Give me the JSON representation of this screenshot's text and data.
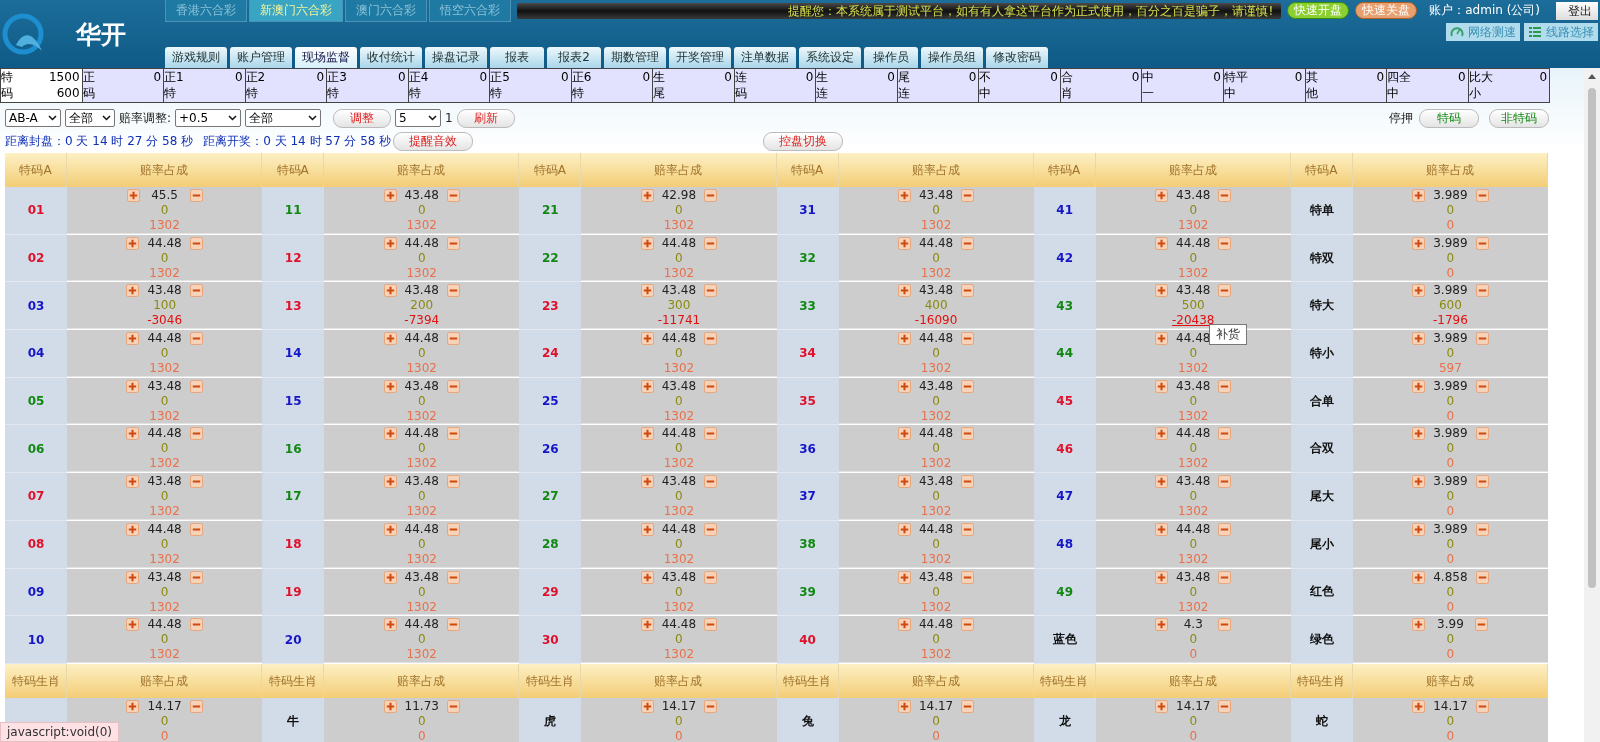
{
  "logo_text": "华开",
  "lottery_tabs": [
    {
      "label": "香港六合彩",
      "selected": false
    },
    {
      "label": "新澳门六合彩",
      "selected": true
    },
    {
      "label": "澳门六合彩",
      "selected": false
    },
    {
      "label": "悟空六合彩",
      "selected": false
    }
  ],
  "notice": "提醒您：本系统属于测试平台，如有有人拿这平台作为正式使用，百分之百是骗子，请谨慎!",
  "quick_buttons": [
    {
      "label": "快速开盘",
      "kind": "open"
    },
    {
      "label": "快速关盘",
      "kind": "close"
    }
  ],
  "account": "账户：admin (公司)",
  "logout": "登出",
  "tools": [
    {
      "label": "网络测速",
      "kind": "speed"
    },
    {
      "label": "线路选择",
      "kind": "list"
    }
  ],
  "nav": [
    {
      "label": "游戏规则",
      "selected": false
    },
    {
      "label": "账户管理",
      "selected": false
    },
    {
      "label": "现场监督",
      "selected": true
    },
    {
      "label": "收付统计",
      "selected": false
    },
    {
      "label": "操盘记录",
      "selected": false
    },
    {
      "label": "报表",
      "selected": false
    },
    {
      "label": "报表2",
      "selected": false
    },
    {
      "label": "期数管理",
      "selected": false
    },
    {
      "label": "开奖管理",
      "selected": false
    },
    {
      "label": "注单数据",
      "selected": false
    },
    {
      "label": "系统设定",
      "selected": false
    },
    {
      "label": "操作员",
      "selected": false
    },
    {
      "label": "操作员组",
      "selected": false
    },
    {
      "label": "修改密码",
      "selected": false
    }
  ],
  "summary": [
    {
      "name": [
        "特",
        "码"
      ],
      "values": [
        "1500",
        "600"
      ],
      "selected": true
    },
    {
      "name": [
        "正",
        "码"
      ],
      "values": [
        "0"
      ],
      "selected": false
    },
    {
      "name": [
        "正1",
        "特"
      ],
      "values": [
        "0"
      ],
      "selected": false
    },
    {
      "name": [
        "正2",
        "特"
      ],
      "values": [
        "0"
      ],
      "selected": false
    },
    {
      "name": [
        "正3",
        "特"
      ],
      "values": [
        "0"
      ],
      "selected": false
    },
    {
      "name": [
        "正4",
        "特"
      ],
      "values": [
        "0"
      ],
      "selected": false
    },
    {
      "name": [
        "正5",
        "特"
      ],
      "values": [
        "0"
      ],
      "selected": false
    },
    {
      "name": [
        "正6",
        "特"
      ],
      "values": [
        "0"
      ],
      "selected": false
    },
    {
      "name": [
        "生",
        "尾"
      ],
      "values": [
        "0"
      ],
      "selected": false
    },
    {
      "name": [
        "连",
        "码"
      ],
      "values": [
        "0"
      ],
      "selected": false
    },
    {
      "name": [
        "生",
        "连"
      ],
      "values": [
        "0"
      ],
      "selected": false
    },
    {
      "name": [
        "尾",
        "连"
      ],
      "values": [
        "0"
      ],
      "selected": false
    },
    {
      "name": [
        "不",
        "中"
      ],
      "values": [
        "0"
      ],
      "selected": false
    },
    {
      "name": [
        "合",
        "肖"
      ],
      "values": [
        "0"
      ],
      "selected": false
    },
    {
      "name": [
        "中",
        "一"
      ],
      "values": [
        "0"
      ],
      "selected": false
    },
    {
      "name": [
        "特平",
        "中"
      ],
      "values": [
        "0"
      ],
      "selected": false
    },
    {
      "name": [
        "其",
        "他"
      ],
      "values": [
        "0"
      ],
      "selected": false
    },
    {
      "name": [
        "四全",
        "中"
      ],
      "values": [
        "0"
      ],
      "selected": false
    },
    {
      "name": [
        "比大",
        "小"
      ],
      "values": [
        "0"
      ],
      "selected": false
    }
  ],
  "controls": {
    "selects": [
      "AB-A",
      "全部"
    ],
    "odds_label": "赔率调整:",
    "odds_selects": [
      "+0.5",
      "全部"
    ],
    "adjust_button": "调整",
    "count_select": "5",
    "count_text": "1",
    "refresh_button": "刷新",
    "stop_label": "停押",
    "stop_buttons": [
      "特码",
      "非特码"
    ]
  },
  "timers": {
    "close": "距离封盘：0 天 14 时 27 分 58 秒",
    "draw": "距离开奖：0 天 14 时 57 分 58 秒",
    "sound_button": "提醒音效",
    "switch_button": "控盘切换"
  },
  "tooltip": "补货",
  "status_text": "javascript:void(0)",
  "sections": [
    {
      "headers": [
        "特码A",
        "赔率占成",
        "特码A",
        "赔率占成",
        "特码A",
        "赔率占成",
        "特码A",
        "赔率占成",
        "特码A",
        "赔率占成",
        "特码A",
        "赔率占成"
      ],
      "rows": [
        [
          {
            "label": "01",
            "color": "#e0102a",
            "odds": "45.5",
            "stake": "0",
            "result": "1302",
            "loss": false
          },
          {
            "label": "11",
            "color": "#118811",
            "odds": "43.48",
            "stake": "0",
            "result": "1302",
            "loss": false
          },
          {
            "label": "21",
            "color": "#118811",
            "odds": "42.98",
            "stake": "0",
            "result": "1302",
            "loss": false
          },
          {
            "label": "31",
            "color": "#1515c8",
            "odds": "43.48",
            "stake": "0",
            "result": "1302",
            "loss": false
          },
          {
            "label": "41",
            "color": "#1515c8",
            "odds": "43.48",
            "stake": "0",
            "result": "1302",
            "loss": false
          },
          {
            "label": "特单",
            "odds": "3.989",
            "stake": "0",
            "result": "0",
            "loss": false
          }
        ],
        [
          {
            "label": "02",
            "color": "#e0102a",
            "odds": "44.48",
            "stake": "0",
            "result": "1302",
            "loss": false
          },
          {
            "label": "12",
            "color": "#e0102a",
            "odds": "44.48",
            "stake": "0",
            "result": "1302",
            "loss": false
          },
          {
            "label": "22",
            "color": "#118811",
            "odds": "44.48",
            "stake": "0",
            "result": "1302",
            "loss": false
          },
          {
            "label": "32",
            "color": "#118811",
            "odds": "44.48",
            "stake": "0",
            "result": "1302",
            "loss": false
          },
          {
            "label": "42",
            "color": "#1515c8",
            "odds": "44.48",
            "stake": "0",
            "result": "1302",
            "loss": false
          },
          {
            "label": "特双",
            "odds": "3.989",
            "stake": "0",
            "result": "0",
            "loss": false
          }
        ],
        [
          {
            "label": "03",
            "color": "#1515c8",
            "odds": "43.48",
            "stake": "100",
            "result": "-3046",
            "loss": true
          },
          {
            "label": "13",
            "color": "#e0102a",
            "odds": "43.48",
            "stake": "200",
            "result": "-7394",
            "loss": true
          },
          {
            "label": "23",
            "color": "#e0102a",
            "odds": "43.48",
            "stake": "300",
            "result": "-11741",
            "loss": true
          },
          {
            "label": "33",
            "color": "#118811",
            "odds": "43.48",
            "stake": "400",
            "result": "-16090",
            "loss": true
          },
          {
            "label": "43",
            "color": "#118811",
            "odds": "43.48",
            "stake": "500",
            "result": "-20438",
            "loss": true,
            "hovered": true
          },
          {
            "label": "特大",
            "odds": "3.989",
            "stake": "600",
            "result": "-1796",
            "loss": true
          }
        ],
        [
          {
            "label": "04",
            "color": "#1515c8",
            "odds": "44.48",
            "stake": "0",
            "result": "1302",
            "loss": false
          },
          {
            "label": "14",
            "color": "#1515c8",
            "odds": "44.48",
            "stake": "0",
            "result": "1302",
            "loss": false
          },
          {
            "label": "24",
            "color": "#e0102a",
            "odds": "44.48",
            "stake": "0",
            "result": "1302",
            "loss": false
          },
          {
            "label": "34",
            "color": "#e0102a",
            "odds": "44.48",
            "stake": "0",
            "result": "1302",
            "loss": false
          },
          {
            "label": "44",
            "color": "#118811",
            "odds": "44.48",
            "stake": "0",
            "result": "1302",
            "loss": false
          },
          {
            "label": "特小",
            "odds": "3.989",
            "stake": "0",
            "result": "597",
            "loss": false
          }
        ],
        [
          {
            "label": "05",
            "color": "#118811",
            "odds": "43.48",
            "stake": "0",
            "result": "1302",
            "loss": false
          },
          {
            "label": "15",
            "color": "#1515c8",
            "odds": "43.48",
            "stake": "0",
            "result": "1302",
            "loss": false
          },
          {
            "label": "25",
            "color": "#1515c8",
            "odds": "43.48",
            "stake": "0",
            "result": "1302",
            "loss": false
          },
          {
            "label": "35",
            "color": "#e0102a",
            "odds": "43.48",
            "stake": "0",
            "result": "1302",
            "loss": false
          },
          {
            "label": "45",
            "color": "#e0102a",
            "odds": "43.48",
            "stake": "0",
            "result": "1302",
            "loss": false
          },
          {
            "label": "合单",
            "odds": "3.989",
            "stake": "0",
            "result": "0",
            "loss": false
          }
        ],
        [
          {
            "label": "06",
            "color": "#118811",
            "odds": "44.48",
            "stake": "0",
            "result": "1302",
            "loss": false
          },
          {
            "label": "16",
            "color": "#118811",
            "odds": "44.48",
            "stake": "0",
            "result": "1302",
            "loss": false
          },
          {
            "label": "26",
            "color": "#1515c8",
            "odds": "44.48",
            "stake": "0",
            "result": "1302",
            "loss": false
          },
          {
            "label": "36",
            "color": "#1515c8",
            "odds": "44.48",
            "stake": "0",
            "result": "1302",
            "loss": false
          },
          {
            "label": "46",
            "color": "#e0102a",
            "odds": "44.48",
            "stake": "0",
            "result": "1302",
            "loss": false
          },
          {
            "label": "合双",
            "odds": "3.989",
            "stake": "0",
            "result": "0",
            "loss": false
          }
        ],
        [
          {
            "label": "07",
            "color": "#e0102a",
            "odds": "43.48",
            "stake": "0",
            "result": "1302",
            "loss": false
          },
          {
            "label": "17",
            "color": "#118811",
            "odds": "43.48",
            "stake": "0",
            "result": "1302",
            "loss": false
          },
          {
            "label": "27",
            "color": "#118811",
            "odds": "43.48",
            "stake": "0",
            "result": "1302",
            "loss": false
          },
          {
            "label": "37",
            "color": "#1515c8",
            "odds": "43.48",
            "stake": "0",
            "result": "1302",
            "loss": false
          },
          {
            "label": "47",
            "color": "#1515c8",
            "odds": "43.48",
            "stake": "0",
            "result": "1302",
            "loss": false
          },
          {
            "label": "尾大",
            "odds": "3.989",
            "stake": "0",
            "result": "0",
            "loss": false
          }
        ],
        [
          {
            "label": "08",
            "color": "#e0102a",
            "odds": "44.48",
            "stake": "0",
            "result": "1302",
            "loss": false
          },
          {
            "label": "18",
            "color": "#e0102a",
            "odds": "44.48",
            "stake": "0",
            "result": "1302",
            "loss": false
          },
          {
            "label": "28",
            "color": "#118811",
            "odds": "44.48",
            "stake": "0",
            "result": "1302",
            "loss": false
          },
          {
            "label": "38",
            "color": "#118811",
            "odds": "44.48",
            "stake": "0",
            "result": "1302",
            "loss": false
          },
          {
            "label": "48",
            "color": "#1515c8",
            "odds": "44.48",
            "stake": "0",
            "result": "1302",
            "loss": false
          },
          {
            "label": "尾小",
            "odds": "3.989",
            "stake": "0",
            "result": "0",
            "loss": false
          }
        ],
        [
          {
            "label": "09",
            "color": "#1515c8",
            "odds": "43.48",
            "stake": "0",
            "result": "1302",
            "loss": false
          },
          {
            "label": "19",
            "color": "#e0102a",
            "odds": "43.48",
            "stake": "0",
            "result": "1302",
            "loss": false
          },
          {
            "label": "29",
            "color": "#e0102a",
            "odds": "43.48",
            "stake": "0",
            "result": "1302",
            "loss": false
          },
          {
            "label": "39",
            "color": "#118811",
            "odds": "43.48",
            "stake": "0",
            "result": "1302",
            "loss": false
          },
          {
            "label": "49",
            "color": "#118811",
            "odds": "43.48",
            "stake": "0",
            "result": "1302",
            "loss": false
          },
          {
            "label": "红色",
            "odds": "4.858",
            "stake": "0",
            "result": "0",
            "loss": false
          }
        ],
        [
          {
            "label": "10",
            "color": "#1515c8",
            "odds": "44.48",
            "stake": "0",
            "result": "1302",
            "loss": false
          },
          {
            "label": "20",
            "color": "#1515c8",
            "odds": "44.48",
            "stake": "0",
            "result": "1302",
            "loss": false
          },
          {
            "label": "30",
            "color": "#e0102a",
            "odds": "44.48",
            "stake": "0",
            "result": "1302",
            "loss": false
          },
          {
            "label": "40",
            "color": "#e0102a",
            "odds": "44.48",
            "stake": "0",
            "result": "1302",
            "loss": false
          },
          {
            "label": "蓝色",
            "odds": "4.3",
            "stake": "0",
            "result": "0",
            "loss": false
          },
          {
            "label": "绿色",
            "odds": "3.99",
            "stake": "0",
            "result": "0",
            "loss": false
          }
        ]
      ]
    },
    {
      "headers": [
        "特码生肖",
        "赔率占成",
        "特码生肖",
        "赔率占成",
        "特码生肖",
        "赔率占成",
        "特码生肖",
        "赔率占成",
        "特码生肖",
        "赔率占成",
        "特码生肖",
        "赔率占成"
      ],
      "rows": [
        [
          {
            "odds": "14.17",
            "stake": "0",
            "result": "0",
            "loss": false
          },
          {
            "label": "牛",
            "odds": "11.73",
            "stake": "0",
            "result": "0",
            "loss": false
          },
          {
            "label": "虎",
            "odds": "14.17",
            "stake": "0",
            "result": "0",
            "loss": false
          },
          {
            "label": "兔",
            "odds": "14.17",
            "stake": "0",
            "result": "0",
            "loss": false
          },
          {
            "label": "龙",
            "odds": "14.17",
            "stake": "0",
            "result": "0",
            "loss": false
          },
          {
            "label": "蛇",
            "odds": "14.17",
            "stake": "0",
            "result": "0",
            "loss": false
          }
        ]
      ]
    }
  ]
}
